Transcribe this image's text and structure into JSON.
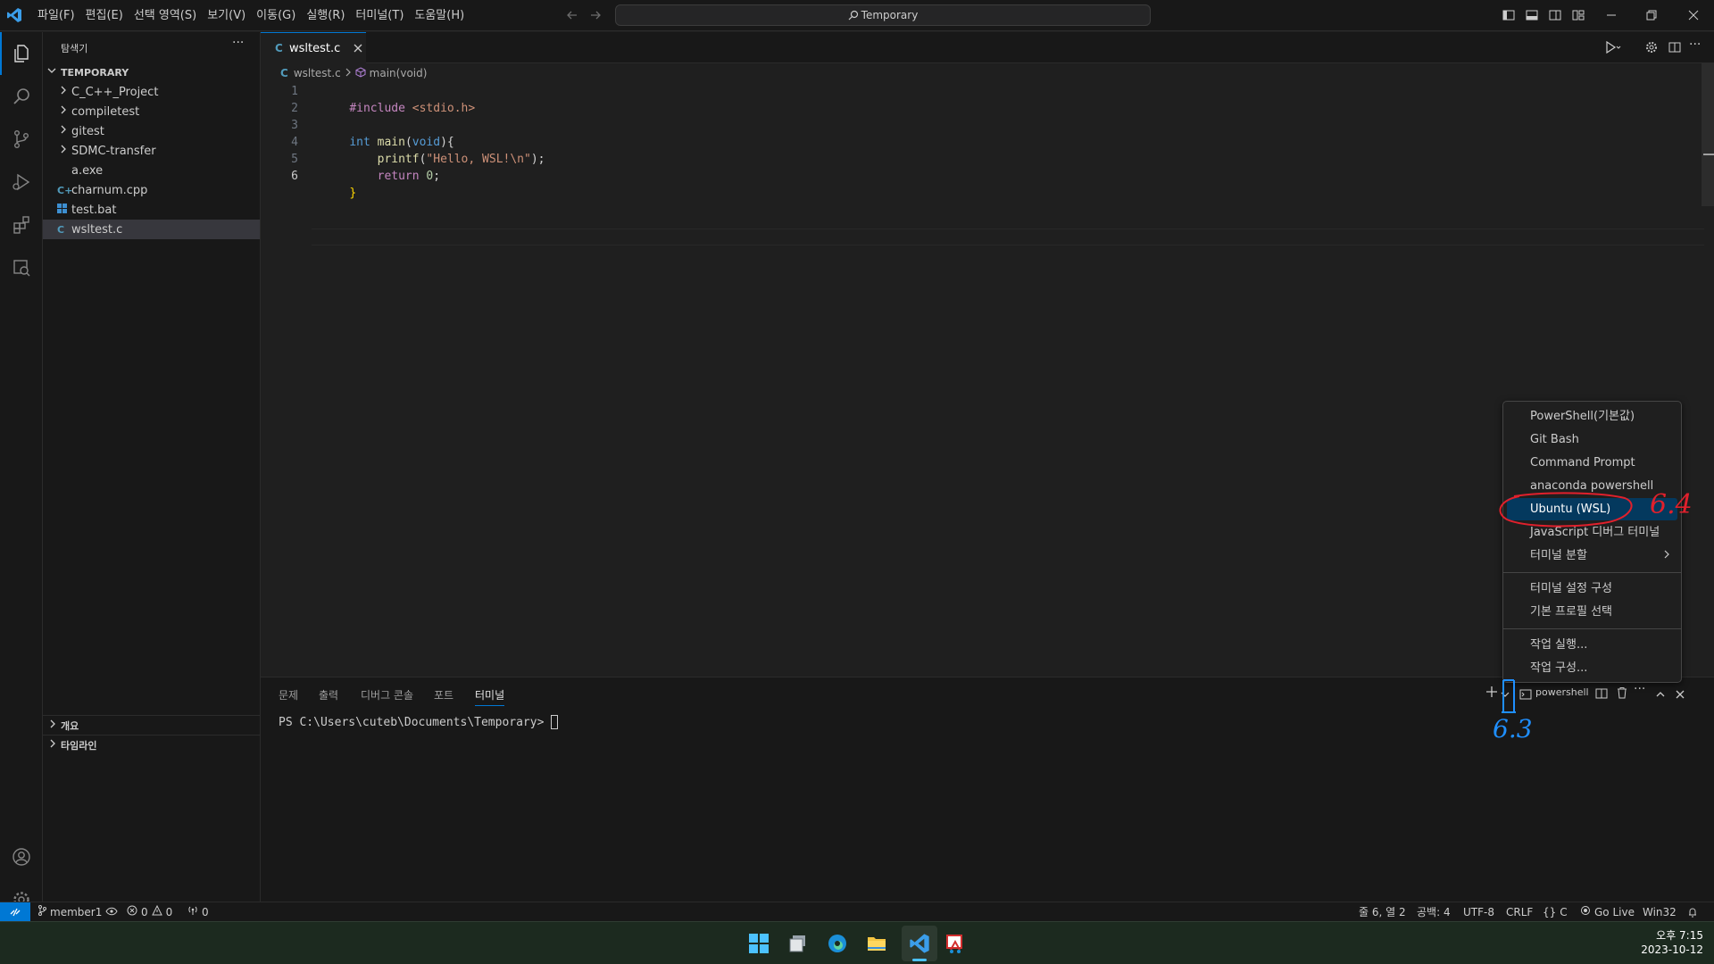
{
  "menu": [
    "파일(F)",
    "편집(E)",
    "선택 영역(S)",
    "보기(V)",
    "이동(G)",
    "실행(R)",
    "터미널(T)",
    "도움말(H)"
  ],
  "search": {
    "text": "Temporary"
  },
  "sidebar": {
    "title": "탐색기",
    "root": "TEMPORARY",
    "items": [
      {
        "label": "C_C++_Project",
        "kind": "folder"
      },
      {
        "label": "compiletest",
        "kind": "folder"
      },
      {
        "label": "gitest",
        "kind": "folder"
      },
      {
        "label": "SDMC-transfer",
        "kind": "folder"
      },
      {
        "label": "a.exe",
        "kind": "file"
      },
      {
        "label": "charnum.cpp",
        "kind": "cpp"
      },
      {
        "label": "test.bat",
        "kind": "bat"
      },
      {
        "label": "wsltest.c",
        "kind": "c"
      }
    ],
    "outline": "개요",
    "timeline": "타임라인"
  },
  "tab": {
    "label": "wsltest.c",
    "lang_icon": "C"
  },
  "breadcrumb": {
    "file": "wsltest.c",
    "symbol": "main(void)"
  },
  "code": {
    "line_numbers": [
      "1",
      "2",
      "3",
      "4",
      "5",
      "6"
    ],
    "l1_directive": "#include",
    "l1_header": " <stdio.h>",
    "l3_type": "int",
    "l3_fn": " main",
    "l3_paren_open": "(",
    "l3_void": "void",
    "l3_rest": "){",
    "l4_indent": "    ",
    "l4_fn": "printf",
    "l4_paren": "(",
    "l4_str": "\"Hello, WSL!\\n\"",
    "l4_end": ");",
    "l5_indent": "    ",
    "l5_kw": "return",
    "l5_num": " 0",
    "l5_end": ";",
    "l6": "}"
  },
  "panel": {
    "tabs": [
      "문제",
      "출력",
      "디버그 콘솔",
      "포트",
      "터미널"
    ],
    "active_tab": "터미널",
    "terminal_name": "powershell",
    "prompt": "PS C:\\Users\\cuteb\\Documents\\Temporary> "
  },
  "dropdown": {
    "group1": [
      "PowerShell(기본값)",
      "Git Bash",
      "Command Prompt",
      "anaconda powershell",
      "Ubuntu (WSL)",
      "JavaScript 디버그 터미널",
      "터미널 분할"
    ],
    "group2": [
      "터미널 설정 구성",
      "기본 프로필 선택"
    ],
    "group3": [
      "작업 실행...",
      "작업 구성..."
    ],
    "highlighted": "Ubuntu (WSL)"
  },
  "annotations": {
    "note_a": "6.4",
    "note_b": "6.3"
  },
  "statusbar": {
    "branch": "member1",
    "errors": "0",
    "warnings": "0",
    "ports": "0",
    "position": "줄 6, 열 2",
    "spaces": "공백: 4",
    "encoding": "UTF-8",
    "eol": "CRLF",
    "language": "C",
    "golive": "Go Live",
    "platform": "Win32"
  },
  "clock": {
    "time": "오후 7:15",
    "date": "2023-10-12"
  },
  "colors": {
    "accent": "#0078d4",
    "highlight": "#04395e",
    "annotation_red": "#e0202c",
    "annotation_blue": "#1f8fff"
  }
}
